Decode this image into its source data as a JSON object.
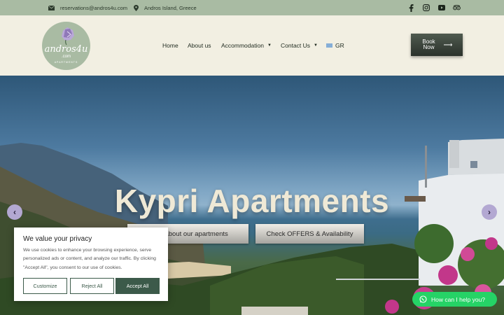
{
  "topbar": {
    "email": "reservations@andros4u.com",
    "location": "Andros Island, Greece",
    "social_icons": [
      "facebook-icon",
      "instagram-icon",
      "youtube-icon",
      "tripadvisor-icon"
    ]
  },
  "logo": {
    "name": "andros4u",
    "domain": ".com",
    "tagline": "APARTMENTS"
  },
  "nav": {
    "items": [
      {
        "label": "Home",
        "has_dropdown": false
      },
      {
        "label": "About us",
        "has_dropdown": false
      },
      {
        "label": "Accommodation",
        "has_dropdown": true
      },
      {
        "label": "Contact Us",
        "has_dropdown": true
      }
    ],
    "language": "GR"
  },
  "book_button": {
    "line1": "Book",
    "line2": "Now"
  },
  "hero": {
    "title": "Kypri Apartments",
    "buttons": [
      "More about our apartments",
      "Check OFFERS & Availability"
    ],
    "prev_label": "‹",
    "next_label": "›"
  },
  "cookie": {
    "title": "We value your privacy",
    "text": "We use cookies to enhance your browsing experience, serve personalized ads or content, and analyze our traffic. By clicking \"Accept All\", you consent to our use of cookies.",
    "customize": "Customize",
    "reject": "Reject All",
    "accept": "Accept All"
  },
  "whatsapp": {
    "label": "How can I help you?"
  },
  "colors": {
    "topbar": "#a9bba3",
    "header_bg": "#f2efe2",
    "accent_green": "#3c5a4a",
    "slider_arrow": "#b3a8d2",
    "whatsapp": "#25d366"
  }
}
